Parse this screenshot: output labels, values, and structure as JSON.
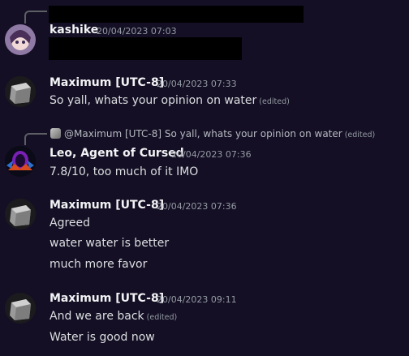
{
  "messages": {
    "kashike": {
      "username": "kashike",
      "timestamp": "20/04/2023 07:03"
    },
    "maximum1": {
      "username": "Maximum [UTC-8]",
      "timestamp": "20/04/2023 07:33",
      "text": "So yall, whats your opinion on water",
      "edited": "(edited)"
    },
    "leo": {
      "reply": {
        "author": "@Maximum [UTC-8]",
        "text": "So yall, whats your opinion on water",
        "edited": "(edited)"
      },
      "username": "Leo, Agent of Cursed",
      "timestamp": "20/04/2023 07:36",
      "text": "7.8/10, too much of it IMO"
    },
    "maximum2": {
      "username": "Maximum [UTC-8]",
      "timestamp": "20/04/2023 07:36",
      "lines": [
        "Agreed",
        "water water is better",
        "much more favor"
      ]
    },
    "maximum3": {
      "username": "Maximum [UTC-8]",
      "timestamp": "20/04/2023 09:11",
      "line1": "And we are back",
      "line1_edited": "(edited)",
      "line2": "Water is good now"
    }
  },
  "colors": {
    "background": "#140f24",
    "username": "#f2f3f5",
    "timestamp": "#949ba4",
    "text": "#dbdee1"
  }
}
